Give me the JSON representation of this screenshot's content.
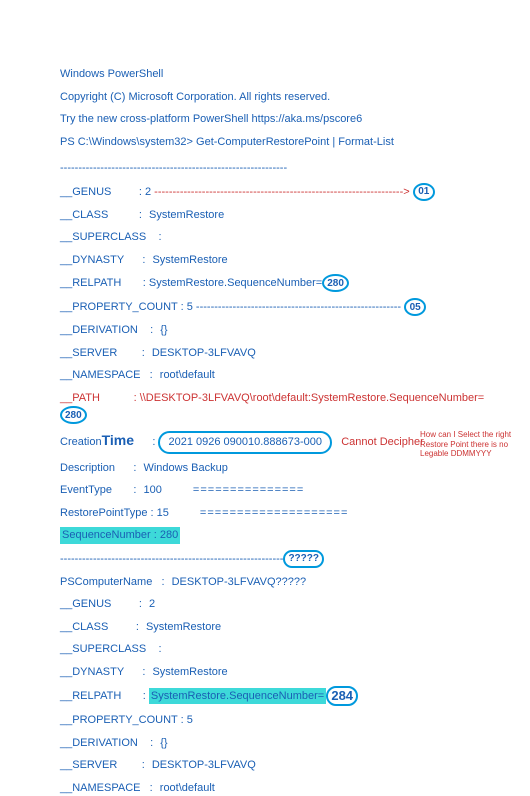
{
  "header": {
    "title": "Windows PowerShell",
    "copyright": "Copyright (C) Microsoft Corporation. All rights reserved.",
    "tryline": "Try the new cross-platform PowerShell https://aka.ms/pscore6",
    "prompt": "PS C:\\Windows\\system32> Get-ComputerRestorePoint | Format-List"
  },
  "sep_top": "--------------------------------------------------------------",
  "entry1": {
    "genus_label": "__GENUS",
    "genus_val": "2",
    "genus_dashes": "-------------------------------------------------------------------->",
    "genus_circle": "01",
    "class_label": "__CLASS",
    "class_val": "SystemRestore",
    "super_label": "__SUPERCLASS",
    "super_val": "",
    "dynasty_label": "__DYNASTY",
    "dynasty_val": "SystemRestore",
    "relpath_label": "__RELPATH",
    "relpath_val": "SystemRestore.SequenceNumber=",
    "relpath_circle": "280",
    "propcount_label": "__PROPERTY_COUNT : 5",
    "propcount_dashes": "--------------------------------------------------------",
    "propcount_circle": "05",
    "deriv_label": "__DERIVATION",
    "deriv_val": "{}",
    "server_label": "__SERVER",
    "server_val": "DESKTOP-3LFVAVQ",
    "ns_label": "__NAMESPACE",
    "ns_val": "root\\default",
    "path_label": "__PATH",
    "path_val": "\\\\DESKTOP-3LFVAVQ\\root\\default:SystemRestore.SequenceNumber=",
    "path_circle": "280",
    "ctime_label": "Creation",
    "ctime_bold": "Time",
    "ctime_val": "2021 0926 090010.888673-000",
    "ctime_note": "Cannot Decipher",
    "side_note": "How can I Select the right Restore Point there is no Legable   DDMMYYY",
    "desc_label": "Description",
    "desc_val": "Windows Backup",
    "etype_label": "EventType",
    "etype_val": "100",
    "etype_eq": "===============",
    "rtype_label": "RestorePointType : 15",
    "rtype_eq": "====================",
    "seqnum": "SequenceNumber    : 280"
  },
  "sep_mid": "-------------------------------------------------------------",
  "mid_circle": "?????",
  "entry2": {
    "pscomp_label": "PSComputerName",
    "pscomp_val": "DESKTOP-3LFVAVQ?????",
    "genus_label": "__GENUS",
    "genus_val": "2",
    "class_label": "__CLASS",
    "class_val": "SystemRestore",
    "super_label": "__SUPERCLASS",
    "super_val": "",
    "dynasty_label": "__DYNASTY",
    "dynasty_val": "SystemRestore",
    "relpath_label": "__RELPATH",
    "relpath_hl": "SystemRestore.SequenceNumber=",
    "relpath_circle": "284",
    "propcount_label": "__PROPERTY_COUNT : 5",
    "deriv_label": "__DERIVATION",
    "deriv_val": "{}",
    "server_label": "__SERVER",
    "server_val": "DESKTOP-3LFVAVQ",
    "ns_label": "__NAMESPACE",
    "ns_val": "root\\default"
  }
}
